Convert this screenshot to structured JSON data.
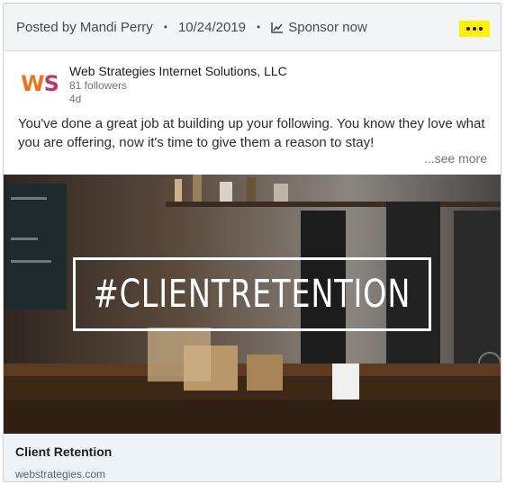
{
  "header": {
    "posted_by": "Posted by Mandi Perry",
    "separator": "•",
    "date": "10/24/2019",
    "sponsor_label": "Sponsor now",
    "more_icon": "ellipsis-icon",
    "chart_icon": "trending-chart-icon"
  },
  "company": {
    "logo_text_w": "W",
    "logo_text_s": "S",
    "name": "Web Strategies Internet Solutions, LLC",
    "followers": "81 followers",
    "age": "4d"
  },
  "post": {
    "text": "You've done a great job at building up your following. You know they love what you are offering, now it's time to give them a reason to stay!",
    "see_more": "...see more"
  },
  "image": {
    "overlay_text": "#CLIENTRETENTION"
  },
  "link": {
    "title": "Client Retention",
    "domain": "webstrategies.com"
  },
  "colors": {
    "highlight": "#fff200",
    "logo_orange": "#e8741e",
    "logo_magenta": "#b83a6b",
    "footer_bg": "#eef3f8",
    "header_bg": "#f3f4f5"
  }
}
